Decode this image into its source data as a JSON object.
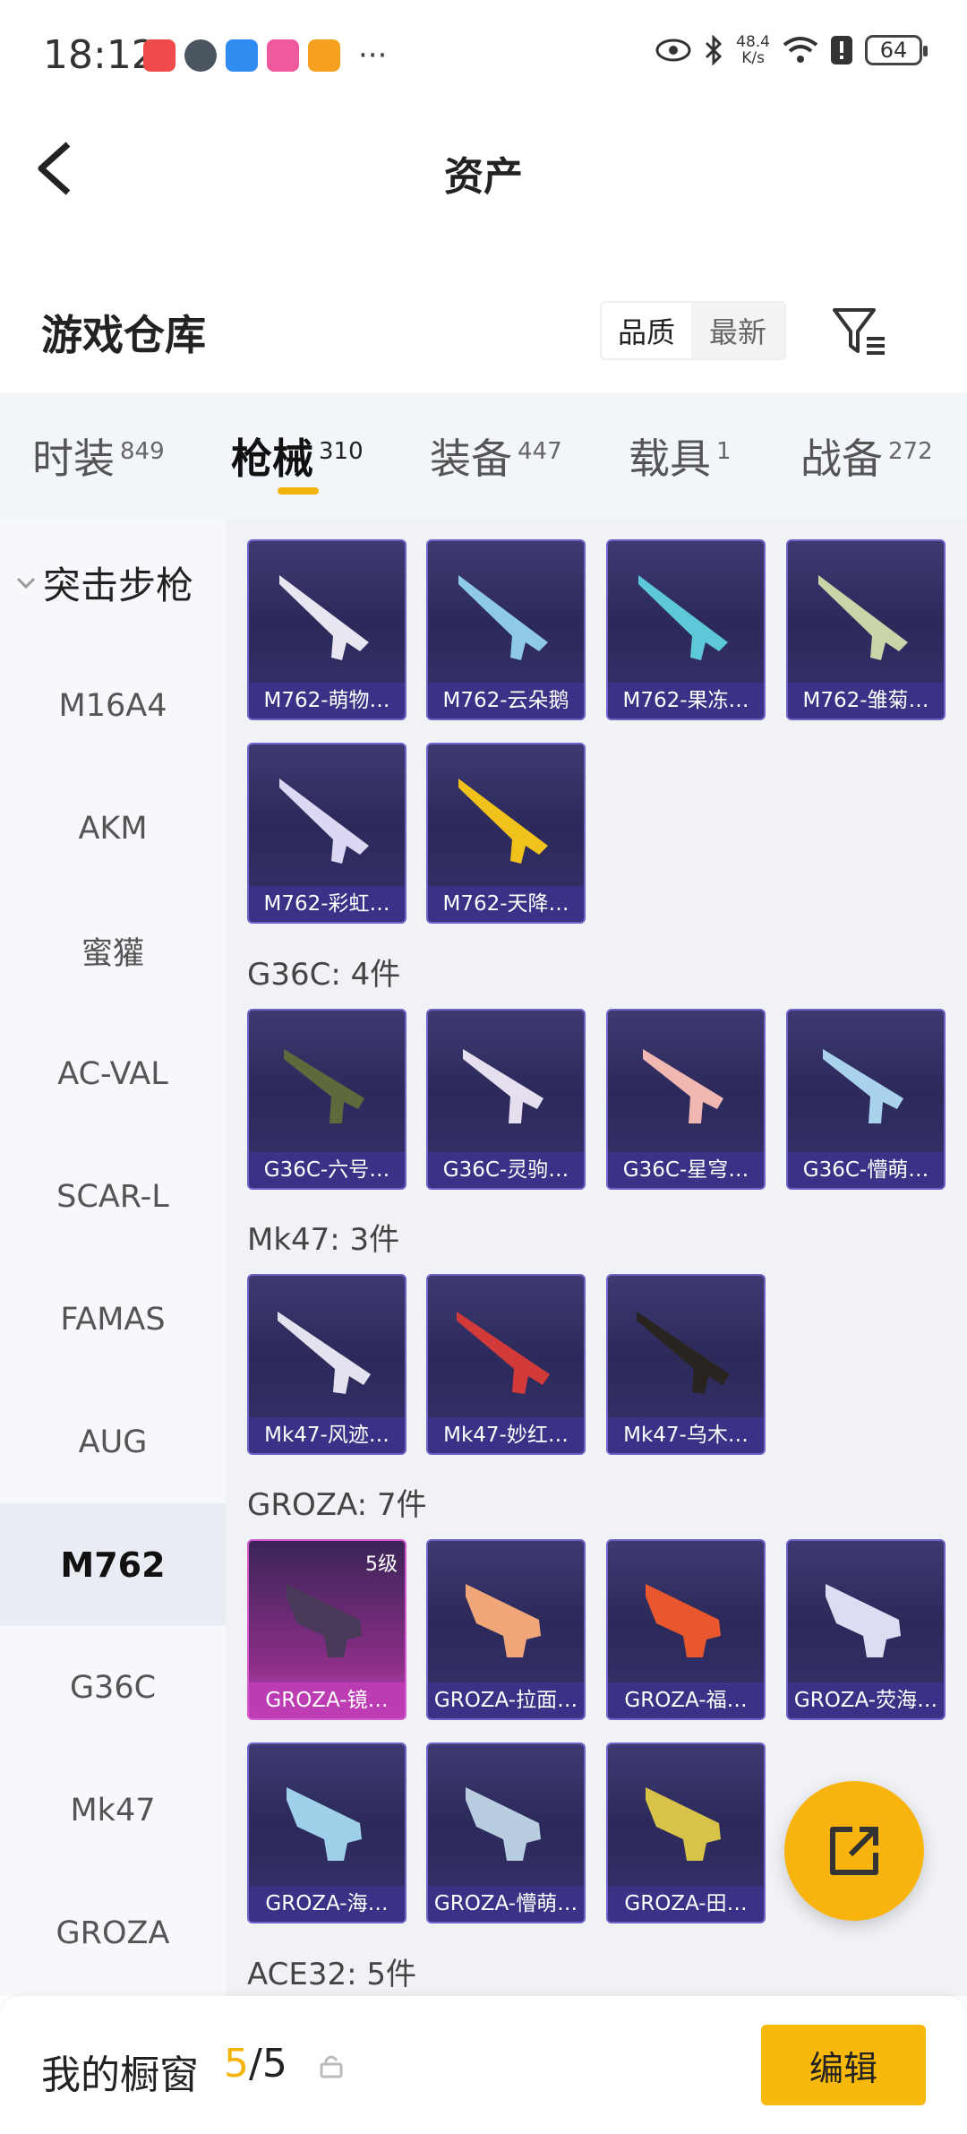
{
  "status_bar": {
    "time": "18:12",
    "network_speed": "48.4",
    "network_unit": "K/s",
    "battery": "64",
    "more": "···"
  },
  "header": {
    "title": "资产",
    "back_icon": "chevron-left-icon"
  },
  "warehouse": {
    "title": "游戏仓库",
    "sort_options": [
      "品质",
      "最新"
    ],
    "sort_selected": "品质",
    "filter_icon": "filter-icon"
  },
  "tabs": [
    {
      "label": "时装",
      "count": "849"
    },
    {
      "label": "枪械",
      "count": "310",
      "active": true
    },
    {
      "label": "装备",
      "count": "447"
    },
    {
      "label": "载具",
      "count": "1"
    },
    {
      "label": "战备",
      "count": "272"
    }
  ],
  "sidebar": {
    "header": "突击步枪",
    "items": [
      "M16A4",
      "AKM",
      "蜜獾",
      "AC-VAL",
      "SCAR-L",
      "FAMAS",
      "AUG",
      "M762",
      "G36C",
      "Mk47",
      "GROZA"
    ],
    "active": "M762"
  },
  "groups": {
    "m762_items": [
      "M762-萌物…",
      "M762-云朵鹅",
      "M762-果冻…",
      "M762-雏菊…",
      "M762-彩虹…",
      "M762-天降…"
    ],
    "g36c_title": "G36C: 4件",
    "g36c_items": [
      "G36C-六号…",
      "G36C-灵驹…",
      "G36C-星穹…",
      "G36C-懵萌…"
    ],
    "mk47_title": "Mk47: 3件",
    "mk47_items": [
      "Mk47-风迹…",
      "Mk47-妙红…",
      "Mk47-乌木…"
    ],
    "groza_title": "GROZA: 7件",
    "groza_items": [
      "GROZA-镜…",
      "GROZA-拉面…",
      "GROZA-福…",
      "GROZA-荧海…",
      "GROZA-海…",
      "GROZA-懵萌…",
      "GROZA-田…"
    ],
    "groza_first_level": "5级",
    "ace32_title": "ACE32: 5件"
  },
  "fab": {
    "icon": "share-external-icon"
  },
  "bottom_bar": {
    "title": "我的橱窗",
    "count_current": "5",
    "count_total": "/5",
    "lock_icon": "lock-icon",
    "edit_label": "编辑"
  },
  "colors": {
    "accent": "#f4b30b",
    "card_bg": "#2c2a5a",
    "card_border": "#6f63c9",
    "rare_pink": "#c64bbf"
  }
}
